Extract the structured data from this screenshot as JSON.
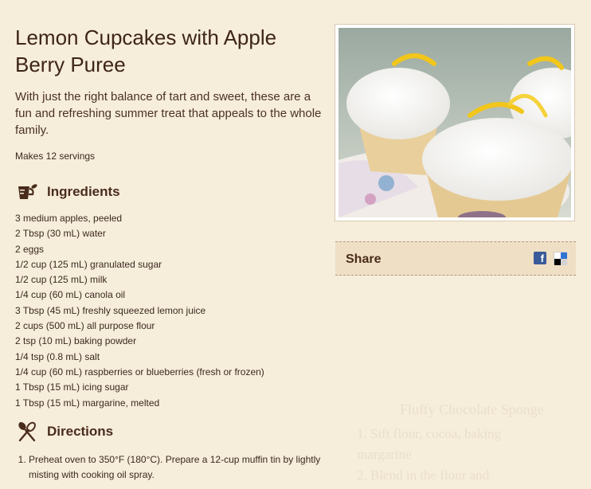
{
  "recipe": {
    "title": "Lemon Cupcakes with Apple Berry Puree",
    "intro": "With just the right balance of tart and sweet, these are a fun and refreshing summer treat that appeals to the whole family.",
    "servings": "Makes 12 servings"
  },
  "ingredients": {
    "heading": "Ingredients",
    "icon": "measuring-cup-icon",
    "items": [
      "3 medium apples, peeled",
      "2 Tbsp (30 mL) water",
      "2 eggs",
      "1/2 cup (125 mL) granulated sugar",
      "1/2 cup (125 mL) milk",
      "1/4 cup (60 mL) canola oil",
      "3 Tbsp (45 mL) freshly squeezed lemon juice",
      "2 cups (500 mL) all purpose flour",
      "2 tsp (10 mL) baking powder",
      "1/4 tsp (0.8 mL) salt",
      "1/4 cup (60 mL) raspberries or blueberries (fresh or frozen)",
      "1 Tbsp (15 mL) icing sugar",
      "1 Tbsp (15 mL) margarine, melted"
    ]
  },
  "directions": {
    "heading": "Directions",
    "icon": "whisk-spatula-icon",
    "steps": [
      "Preheat oven to 350°F (180°C). Prepare a 12-cup muffin tin by lightly misting with cooking oil spray."
    ]
  },
  "share": {
    "label": "Share",
    "icons": [
      "facebook-icon",
      "delicious-icon"
    ]
  },
  "background_card": {
    "title": "Fluffy Chocolate Sponge",
    "lines": [
      "1.  Sift flour, cocoa, baking",
      "     margarine",
      "2.  Blend in the flour and"
    ]
  },
  "colors": {
    "page_bg": "#f7eddb",
    "heading": "#4a2c1c",
    "share_bg": "#efdfc4",
    "facebook": "#3b5a9a"
  }
}
